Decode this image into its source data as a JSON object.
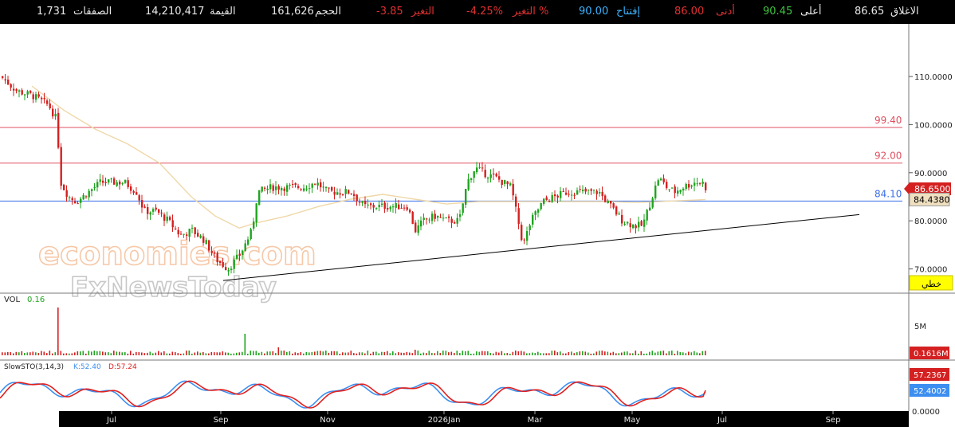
{
  "quote_bar": {
    "close": {
      "label": "الاغلاق",
      "value": "86.65"
    },
    "high": {
      "label": "أعلى",
      "value": "90.45"
    },
    "low": {
      "label": "أدنى",
      "value": "86.00"
    },
    "open": {
      "label": "إفتتاح",
      "value": "90.00"
    },
    "pct_change": {
      "label": "التغير %",
      "value": "-4.25%"
    },
    "change": {
      "label": "التغير",
      "value": "-3.85"
    },
    "volume": {
      "label": "الحجم",
      "value": "161,626"
    },
    "value": {
      "label": "القيمة",
      "value": "14,210,417"
    },
    "trades": {
      "label": "الصفقات",
      "value": "1,731"
    }
  },
  "main_panel": {
    "price_ticks": [
      "110.0000",
      "100.0000",
      "90.0000",
      "80.0000",
      "70.0000"
    ],
    "last_price_badge": "86.6500",
    "ma_badge": "84.4380",
    "linear_button": "خطي",
    "h_lines": [
      {
        "label": "99.40",
        "value": 99.4,
        "color": "#e05060"
      },
      {
        "label": "92.00",
        "value": 92.0,
        "color": "#e05060"
      },
      {
        "label": "84.10",
        "value": 84.1,
        "color": "#3a6ee8"
      }
    ],
    "watermark_line1": "economies.com",
    "watermark_line2": "FxNewsToday"
  },
  "volume_panel": {
    "title": "VOL",
    "value": "0.16",
    "tick": "5M",
    "badge": "0.1616M"
  },
  "stoch_panel": {
    "title": "SlowSTO(3,14,3)",
    "k_text": "K:52.40",
    "d_text": "D:57.24",
    "badge_d": "57.2367",
    "badge_k": "52.4002",
    "tick_zero": "0.0000"
  },
  "x_axis": {
    "labels": [
      "Jul",
      "Sep",
      "Nov",
      "2026Jan",
      "Mar",
      "May",
      "Jul",
      "Sep"
    ]
  },
  "colors": {
    "up": "#1fa51f",
    "down": "#d42020",
    "ma": "#efd8a8",
    "k_line": "#3c8ef0",
    "d_line": "#e02020"
  },
  "chart_data": {
    "type": "candlestick",
    "x_tick_labels": [
      "Jul",
      "Sep",
      "Nov",
      "2026Jan",
      "Mar",
      "May",
      "Jul",
      "Sep"
    ],
    "ylim": [
      64,
      118
    ],
    "close_path": [
      [
        0,
        110
      ],
      [
        20,
        107
      ],
      [
        40,
        106
      ],
      [
        60,
        104
      ],
      [
        70,
        101
      ],
      [
        75,
        88
      ],
      [
        85,
        85
      ],
      [
        95,
        84
      ],
      [
        110,
        86
      ],
      [
        125,
        88
      ],
      [
        140,
        88
      ],
      [
        155,
        88
      ],
      [
        170,
        86
      ],
      [
        180,
        82
      ],
      [
        195,
        82
      ],
      [
        210,
        80
      ],
      [
        225,
        77
      ],
      [
        240,
        78
      ],
      [
        255,
        76
      ],
      [
        270,
        72
      ],
      [
        285,
        70
      ],
      [
        300,
        73
      ],
      [
        315,
        78
      ],
      [
        322,
        86
      ],
      [
        340,
        87
      ],
      [
        360,
        87
      ],
      [
        380,
        87
      ],
      [
        395,
        88
      ],
      [
        410,
        86
      ],
      [
        425,
        86
      ],
      [
        440,
        86
      ],
      [
        455,
        83
      ],
      [
        470,
        83
      ],
      [
        490,
        83
      ],
      [
        510,
        83
      ],
      [
        520,
        78
      ],
      [
        530,
        80
      ],
      [
        545,
        81
      ],
      [
        560,
        80
      ],
      [
        575,
        80
      ],
      [
        585,
        88
      ],
      [
        595,
        91
      ],
      [
        605,
        90
      ],
      [
        620,
        89
      ],
      [
        640,
        87
      ],
      [
        650,
        79
      ],
      [
        655,
        75
      ],
      [
        665,
        80
      ],
      [
        680,
        84
      ],
      [
        695,
        85
      ],
      [
        710,
        86
      ],
      [
        730,
        86
      ],
      [
        750,
        86
      ],
      [
        765,
        83
      ],
      [
        780,
        80
      ],
      [
        795,
        79
      ],
      [
        805,
        79
      ],
      [
        815,
        84
      ],
      [
        825,
        89
      ],
      [
        835,
        87
      ],
      [
        845,
        86
      ],
      [
        855,
        87
      ],
      [
        870,
        88
      ],
      [
        880,
        88
      ],
      [
        885,
        86.65
      ]
    ],
    "ma_path": [
      [
        40,
        108
      ],
      [
        80,
        103
      ],
      [
        120,
        99
      ],
      [
        160,
        96
      ],
      [
        200,
        92
      ],
      [
        240,
        85
      ],
      [
        270,
        81
      ],
      [
        300,
        78.5
      ],
      [
        320,
        79.5
      ],
      [
        360,
        81
      ],
      [
        400,
        83
      ],
      [
        440,
        84.5
      ],
      [
        480,
        85.5
      ],
      [
        520,
        84.5
      ],
      [
        560,
        83.5
      ],
      [
        600,
        84
      ],
      [
        640,
        84
      ],
      [
        680,
        84
      ],
      [
        720,
        84
      ],
      [
        760,
        84
      ],
      [
        800,
        83.8
      ],
      [
        840,
        84.1
      ],
      [
        870,
        84.3
      ],
      [
        885,
        84.438
      ]
    ],
    "trendline": [
      [
        280,
        67.6
      ],
      [
        1078,
        81.3
      ]
    ],
    "h_lines": [
      99.4,
      92.0,
      84.1
    ],
    "last_price": 86.65,
    "ma_last": 84.438,
    "volume": {
      "last": 0.1616,
      "tick_5M": 5
    },
    "stochastic": {
      "K": 52.4002,
      "D": 57.2367,
      "ylim": [
        0,
        100
      ]
    }
  }
}
